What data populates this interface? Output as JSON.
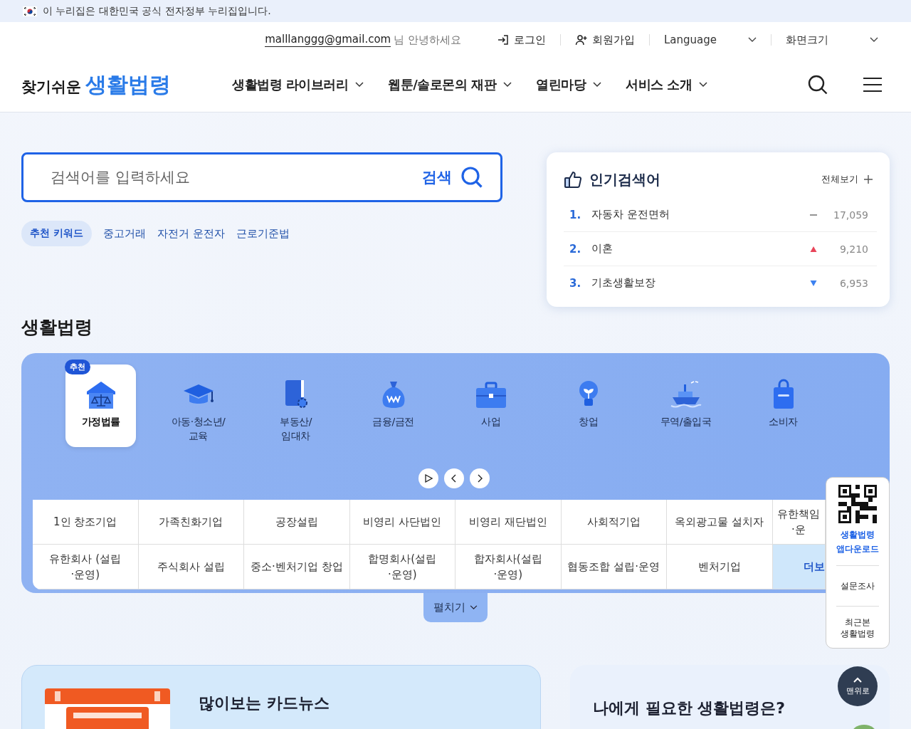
{
  "gov_banner": {
    "text": "이 누리집은 대한민국 공식 전자정부 누리집입니다."
  },
  "utility": {
    "email": "malllanggg@gmail.com",
    "greeting": "님 안녕하세요",
    "login": "로그인",
    "signup": "회원가입",
    "language": "Language",
    "screen_size": "화면크기"
  },
  "header": {
    "logo_small": "찾기쉬운",
    "logo_big": "생활법령",
    "nav": [
      "생활법령 라이브러리",
      "웹툰/솔로몬의 재판",
      "열린마당",
      "서비스 소개"
    ]
  },
  "search": {
    "placeholder": "검색어를 입력하세요",
    "button": "검색",
    "keywords_label": "추천 키워드",
    "keywords": [
      "중고거래",
      "자전거 운전자",
      "근로기준법"
    ]
  },
  "popular": {
    "title": "인기검색어",
    "view_all": "전체보기",
    "items": [
      {
        "rank": "1.",
        "term": "자동차 운전면허",
        "rising": false,
        "falling": false,
        "count": "17,059"
      },
      {
        "rank": "2.",
        "term": "이혼",
        "rising": true,
        "falling": false,
        "count": "9,210"
      },
      {
        "rank": "3.",
        "term": "기초생활보장",
        "rising": false,
        "falling": true,
        "count": "6,953"
      }
    ]
  },
  "section_title": "생활법령",
  "categories": [
    {
      "label": "가정법률",
      "selected": true,
      "badge": "추천"
    },
    {
      "label": "아동·청소년/\n교육",
      "selected": false
    },
    {
      "label": "부동산/\n임대차",
      "selected": false
    },
    {
      "label": "금융/금전",
      "selected": false
    },
    {
      "label": "사업",
      "selected": false
    },
    {
      "label": "창업",
      "selected": false
    },
    {
      "label": "무역/출입국",
      "selected": false
    },
    {
      "label": "소비자",
      "selected": false
    }
  ],
  "topics": [
    {
      "label": "1인 창조기업"
    },
    {
      "label": "가족친화기업"
    },
    {
      "label": "공장설립"
    },
    {
      "label": "비영리 사단법인"
    },
    {
      "label": "비영리 재단법인"
    },
    {
      "label": "사회적기업"
    },
    {
      "label": "옥외광고물 설치자"
    },
    {
      "label": "유한책임\n·운"
    },
    {
      "label": "유한회사 (설립\n·운영)"
    },
    {
      "label": "주식회사 설립"
    },
    {
      "label": "중소·벤처기업 창업"
    },
    {
      "label": "합명회사(설립\n·운영)"
    },
    {
      "label": "합자회사(설립\n·운영)"
    },
    {
      "label": "협동조합 설립·운영"
    },
    {
      "label": "벤처기업"
    },
    {
      "label": "더보",
      "kind": "more"
    }
  ],
  "expand_button": "펼치기",
  "side_panel": {
    "app_download": "생활법령\n앱다운로드",
    "survey": "설문조사",
    "recent": "최근본\n생활법령"
  },
  "top_button": "맨위로",
  "card_news": {
    "title": "많이보는 카드뉴스"
  },
  "needs": {
    "title": "나에게 필요한 생활법령은?"
  }
}
